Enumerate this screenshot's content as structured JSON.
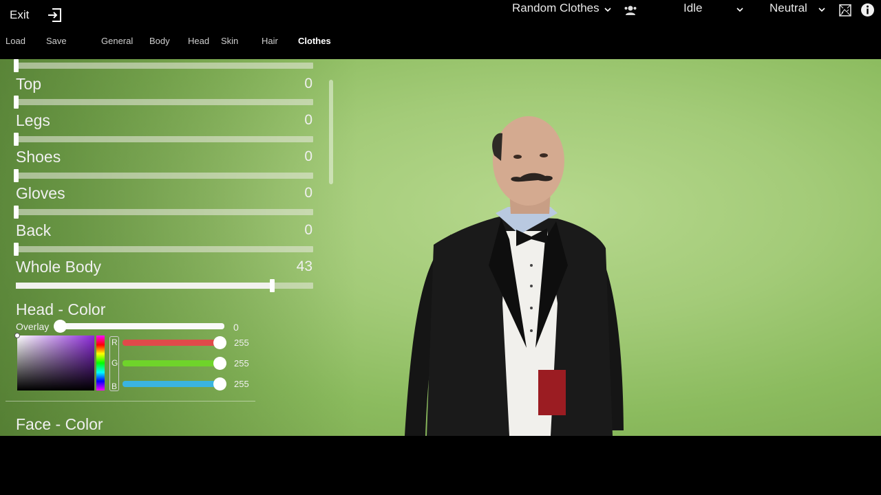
{
  "header": {
    "exit_label": "Exit",
    "nav": [
      "Load",
      "Save",
      "General",
      "Body",
      "Head",
      "Skin",
      "Hair",
      "Clothes"
    ],
    "active_tab": "Clothes",
    "clothes_dropdown": "Random Clothes",
    "pose_dropdown": "Idle",
    "expression_dropdown": "Neutral"
  },
  "panel": {
    "slots": [
      {
        "label": "Top",
        "value": "0",
        "fraction": 0
      },
      {
        "label": "Legs",
        "value": "0",
        "fraction": 0
      },
      {
        "label": "Shoes",
        "value": "0",
        "fraction": 0
      },
      {
        "label": "Gloves",
        "value": "0",
        "fraction": 0
      },
      {
        "label": "Back",
        "value": "0",
        "fraction": 0
      },
      {
        "label": "Whole Body",
        "value": "43",
        "fraction": 0.86
      }
    ],
    "head_color": {
      "title": "Head - Color",
      "overlay_label": "Overlay",
      "overlay_value": "0",
      "r_label": "R",
      "g_label": "G",
      "b_label": "B",
      "r": "255",
      "g": "255",
      "b": "255"
    },
    "face_color_title": "Face - Color"
  },
  "icons": {
    "exit": "exit-door-icon",
    "group": "people-icon",
    "screenshot": "picture-frame-icon",
    "info": "info-icon"
  },
  "colors": {
    "background_green": "#a3cb78",
    "r_track": "#e04a4a",
    "g_track": "#6fd42a",
    "b_track": "#3ab4e0"
  }
}
